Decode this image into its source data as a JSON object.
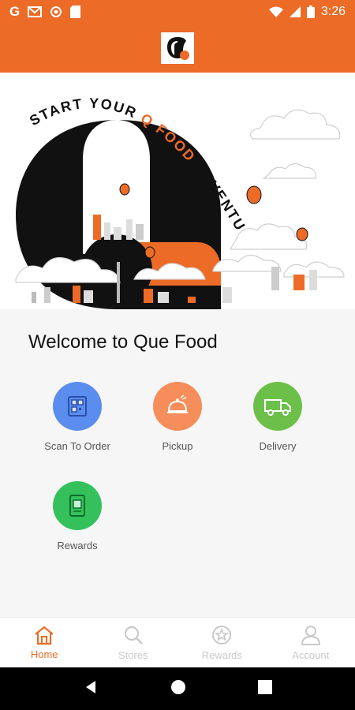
{
  "status_bar": {
    "time": "3:26",
    "left_icons": [
      "gmail-g-icon",
      "gmail-m-icon",
      "sync-icon",
      "sd-card-icon"
    ],
    "right_icons": [
      "wifi-icon",
      "signal-icon",
      "battery-icon"
    ]
  },
  "app_bar": {
    "logo_letter": "Q"
  },
  "hero": {
    "headline_part1": "START YOUR",
    "headline_highlight": "Q FOOD",
    "headline_part2": "ADVENTURE"
  },
  "main": {
    "welcome": "Welcome to Que Food",
    "actions": [
      {
        "label": "Scan To Order",
        "icon": "qr-menu-icon",
        "color": "#5b8def"
      },
      {
        "label": "Pickup",
        "icon": "cloche-icon",
        "color": "#f68d5a"
      },
      {
        "label": "Delivery",
        "icon": "truck-icon",
        "color": "#6cc04a"
      },
      {
        "label": "Rewards",
        "icon": "rewards-card-icon",
        "color": "#34c15c"
      }
    ]
  },
  "bottom_nav": {
    "items": [
      {
        "label": "Home",
        "icon": "home-icon",
        "active": true
      },
      {
        "label": "Stores",
        "icon": "search-icon",
        "active": false
      },
      {
        "label": "Rewards",
        "icon": "star-badge-icon",
        "active": false
      },
      {
        "label": "Account",
        "icon": "user-icon",
        "active": false
      }
    ]
  },
  "colors": {
    "brand": "#ec6b27",
    "inactive_nav": "#c9c9c9"
  }
}
